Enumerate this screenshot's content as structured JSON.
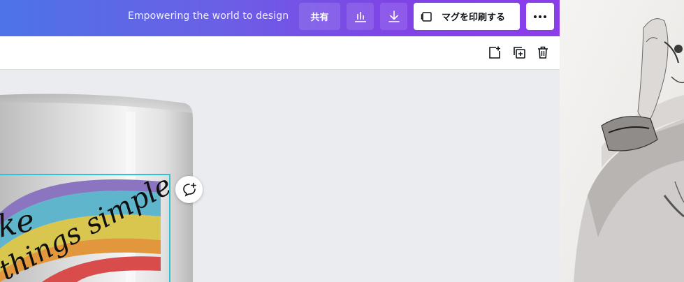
{
  "header": {
    "tagline": "Empowering the world to design",
    "share_label": "共有",
    "print_label": "マグを印刷する"
  },
  "canvas": {
    "mug_text_line1": "ke",
    "mug_text_line2": "things simple"
  },
  "colors": {
    "accent_gradient_start": "#4d73e8",
    "accent_gradient_end": "#8b3dea",
    "selection": "#2ec4d6",
    "rainbow": [
      "#8b75c0",
      "#5fb6cc",
      "#d9c64f",
      "#e3973d",
      "#d94c4c"
    ]
  },
  "icons": {
    "stats": "bar-chart-icon",
    "download": "download-icon",
    "print": "mug-icon",
    "more": "more-dots-icon",
    "add_page": "add-page-icon",
    "duplicate": "duplicate-icon",
    "delete": "trash-icon",
    "comment": "add-comment-icon"
  }
}
